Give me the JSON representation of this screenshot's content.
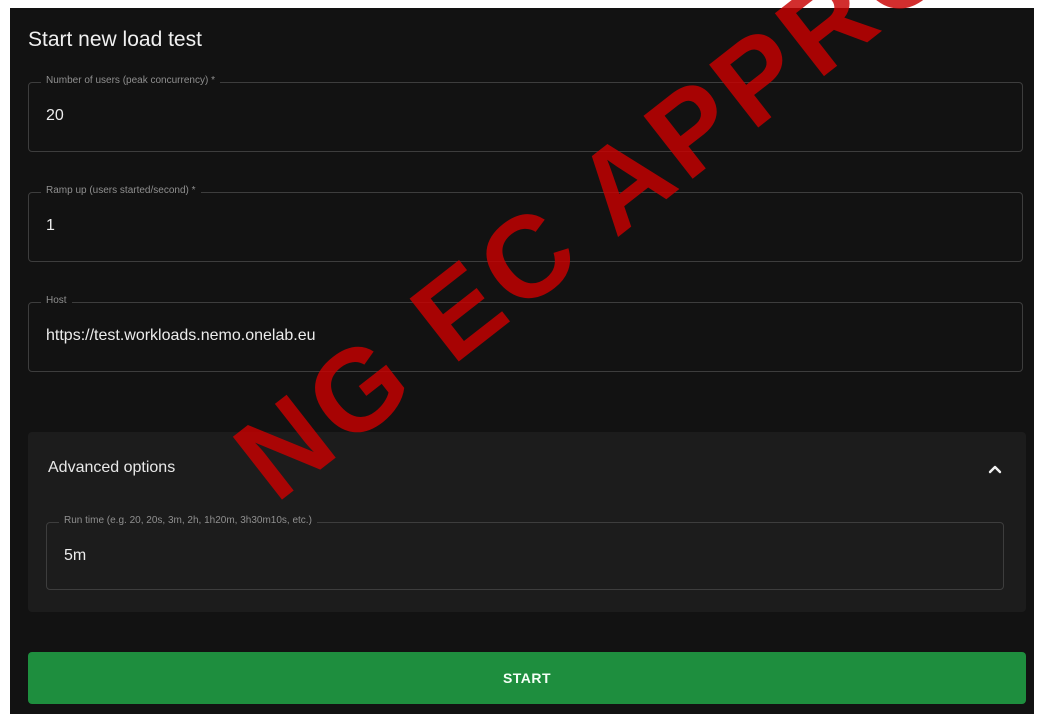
{
  "form": {
    "title": "Start new load test",
    "users": {
      "label": "Number of users (peak concurrency) *",
      "value": "20"
    },
    "ramp_up": {
      "label": "Ramp up (users started/second) *",
      "value": "1"
    },
    "host": {
      "label": "Host",
      "value": "https://test.workloads.nemo.onelab.eu"
    }
  },
  "advanced": {
    "title": "Advanced options",
    "expand_icon": "chevron-up-icon",
    "run_time": {
      "label": "Run time (e.g. 20, 20s, 3m, 2h, 1h20m, 3h30m10s, etc.)",
      "value": "5m"
    }
  },
  "actions": {
    "start_label": "START"
  },
  "watermark": {
    "text": "NG EC APPRO"
  },
  "colors": {
    "background": "#121212",
    "accordion": "#1c1c1c",
    "start_button": "#1e8e3e",
    "watermark": "#c80000"
  }
}
